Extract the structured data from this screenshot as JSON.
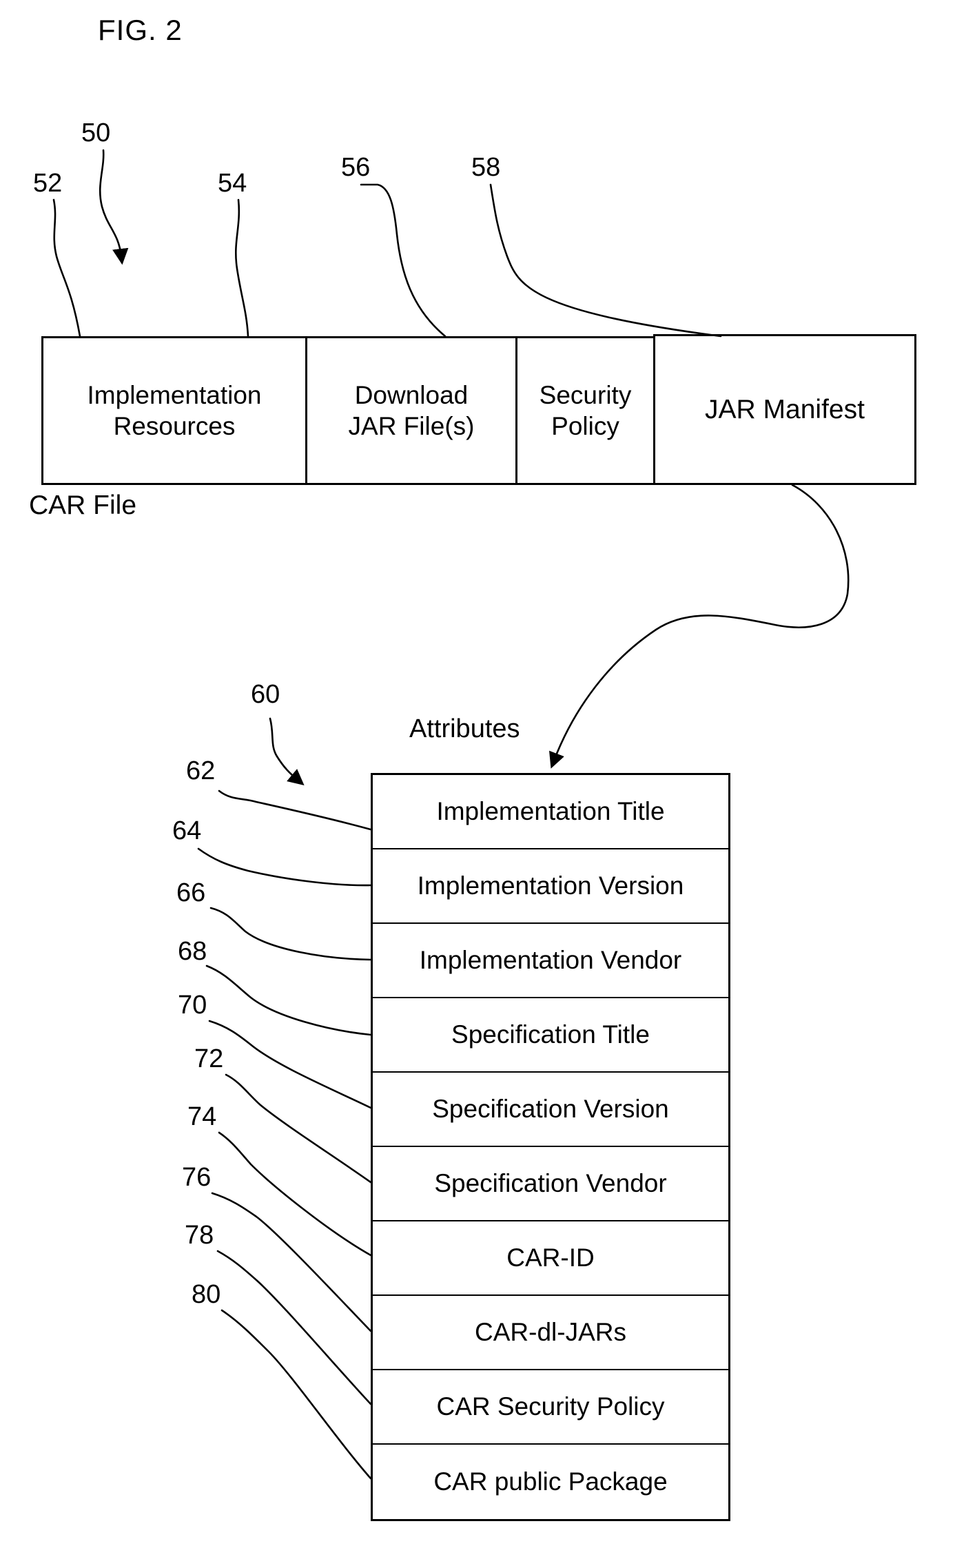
{
  "figure": {
    "title": "FIG. 2"
  },
  "car_file": {
    "label": "CAR File",
    "cells": [
      {
        "ref": "52",
        "label": "Implementation\nResources"
      },
      {
        "ref": "54",
        "label": "Download\nJAR File(s)"
      },
      {
        "ref": "56",
        "label": "Security\nPolicy"
      },
      {
        "ref": "58",
        "label": "JAR Manifest"
      }
    ],
    "cell_labels": {
      "implementation_resources_line1": "Implementation",
      "implementation_resources_line2": "Resources",
      "download_jar_line1": "Download",
      "download_jar_line2": "JAR File(s)",
      "security_policy_line1": "Security",
      "security_policy_line2": "Policy",
      "jar_manifest": "JAR Manifest"
    },
    "ref_overall": "50"
  },
  "attributes": {
    "label": "Attributes",
    "ref_overall": "60",
    "rows": [
      {
        "ref": "62",
        "label": "Implementation Title"
      },
      {
        "ref": "64",
        "label": "Implementation Version"
      },
      {
        "ref": "66",
        "label": "Implementation Vendor"
      },
      {
        "ref": "68",
        "label": "Specification Title"
      },
      {
        "ref": "70",
        "label": "Specification Version"
      },
      {
        "ref": "72",
        "label": "Specification Vendor"
      },
      {
        "ref": "74",
        "label": "CAR-ID"
      },
      {
        "ref": "76",
        "label": "CAR-dl-JARs"
      },
      {
        "ref": "78",
        "label": "CAR Security Policy"
      },
      {
        "ref": "80",
        "label": "CAR public Package"
      }
    ]
  },
  "colors": {
    "ink": "#000000",
    "paper": "#ffffff"
  }
}
